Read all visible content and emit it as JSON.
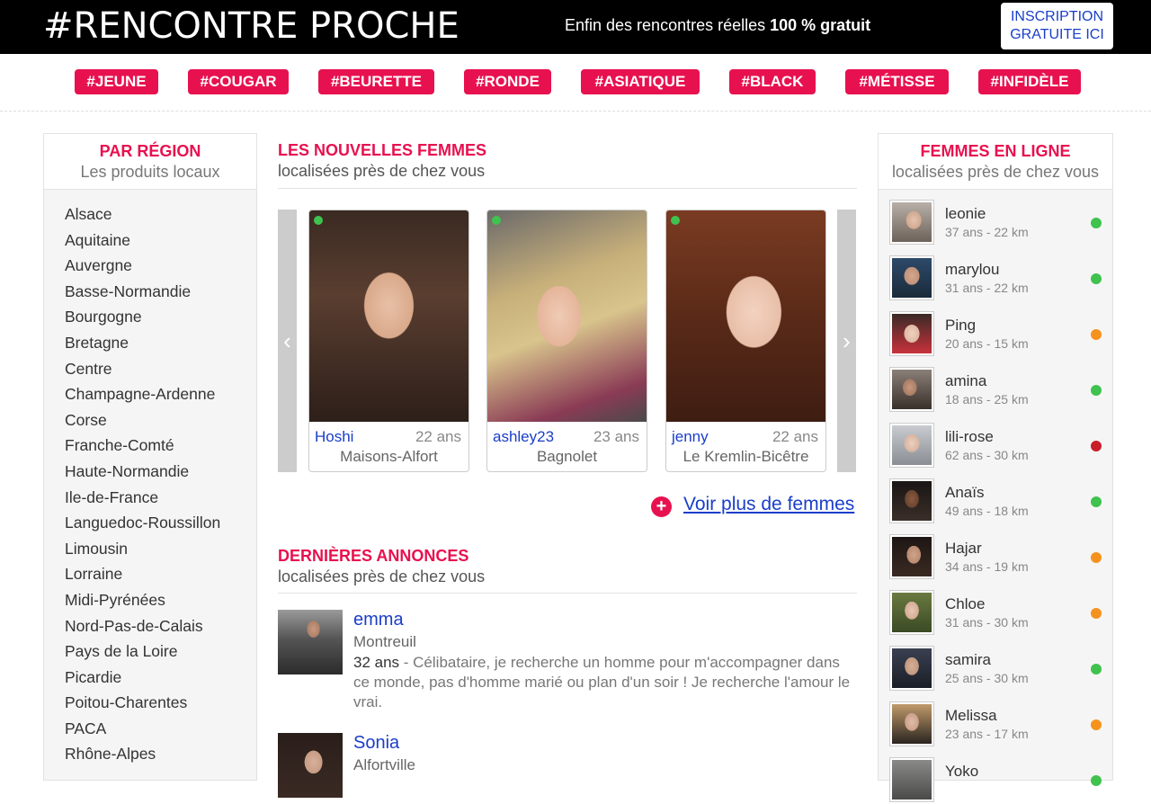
{
  "header": {
    "logo": "#RENCONTRE PROCHE",
    "tagline_prefix": "Enfin des rencontres réelles",
    "tagline_bold": "100 % gratuit",
    "signup_line1": "INSCRIPTION",
    "signup_line2": "GRATUITE ICI"
  },
  "tags": [
    "#JEUNE",
    "#COUGAR",
    "#BEURETTE",
    "#RONDE",
    "#ASIATIQUE",
    "#BLACK",
    "#MÉTISSE",
    "#INFIDÈLE"
  ],
  "regions_box": {
    "title": "PAR RÉGION",
    "subtitle": "Les produits locaux",
    "items": [
      "Alsace",
      "Aquitaine",
      "Auvergne",
      "Basse-Normandie",
      "Bourgogne",
      "Bretagne",
      "Centre",
      "Champagne-Ardenne",
      "Corse",
      "Franche-Comté",
      "Haute-Normandie",
      "Ile-de-France",
      "Languedoc-Roussillon",
      "Limousin",
      "Lorraine",
      "Midi-Pyrénées",
      "Nord-Pas-de-Calais",
      "Pays de la Loire",
      "Picardie",
      "Poitou-Charentes",
      "PACA",
      "Rhône-Alpes"
    ]
  },
  "new_women": {
    "title": "LES NOUVELLES FEMMES",
    "subtitle": "localisées près de chez vous",
    "prev_icon": "chevron-left-icon",
    "next_icon": "chevron-right-icon",
    "cards": [
      {
        "name": "Hoshi",
        "age": "22 ans",
        "city": "Maisons-Alfort"
      },
      {
        "name": "ashley23",
        "age": "23 ans",
        "city": "Bagnolet"
      },
      {
        "name": "jenny",
        "age": "22 ans",
        "city": "Le Kremlin-Bicêtre"
      }
    ],
    "more_link": "Voir plus de femmes"
  },
  "ads": {
    "title": "DERNIÈRES ANNONCES",
    "subtitle": "localisées près de chez vous",
    "items": [
      {
        "name": "emma",
        "city": "Montreuil",
        "age": "32 ans",
        "text": " - Célibataire, je recherche un homme pour m'accompagner dans ce monde, pas d'homme marié ou plan d'un soir ! Je recherche l'amour le vrai."
      },
      {
        "name": "Sonia",
        "city": "Alfortville"
      }
    ]
  },
  "online_box": {
    "title": "FEMMES EN LIGNE",
    "subtitle": "localisées près de chez vous",
    "users": [
      {
        "name": "leonie",
        "meta": "37 ans - 22 km",
        "status_color": "#3fc24e"
      },
      {
        "name": "marylou",
        "meta": "31 ans - 22 km",
        "status_color": "#3fc24e"
      },
      {
        "name": "Ping",
        "meta": "20 ans - 15 km",
        "status_color": "#f5921e"
      },
      {
        "name": "amina",
        "meta": "18 ans - 25 km",
        "status_color": "#3fc24e"
      },
      {
        "name": "lili-rose",
        "meta": "62 ans - 30 km",
        "status_color": "#c81e28"
      },
      {
        "name": "Anaïs",
        "meta": "49 ans - 18 km",
        "status_color": "#3fc24e"
      },
      {
        "name": "Hajar",
        "meta": "34 ans - 19 km",
        "status_color": "#f5921e"
      },
      {
        "name": "Chloe",
        "meta": "31 ans - 30 km",
        "status_color": "#f5921e"
      },
      {
        "name": "samira",
        "meta": "25 ans - 30 km",
        "status_color": "#3fc24e"
      },
      {
        "name": "Melissa",
        "meta": "23 ans - 17 km",
        "status_color": "#f5921e"
      },
      {
        "name": "Yoko",
        "meta": "",
        "status_color": "#3fc24e"
      }
    ]
  },
  "colors": {
    "accent": "#e8114f",
    "link": "#1a3ec9"
  }
}
